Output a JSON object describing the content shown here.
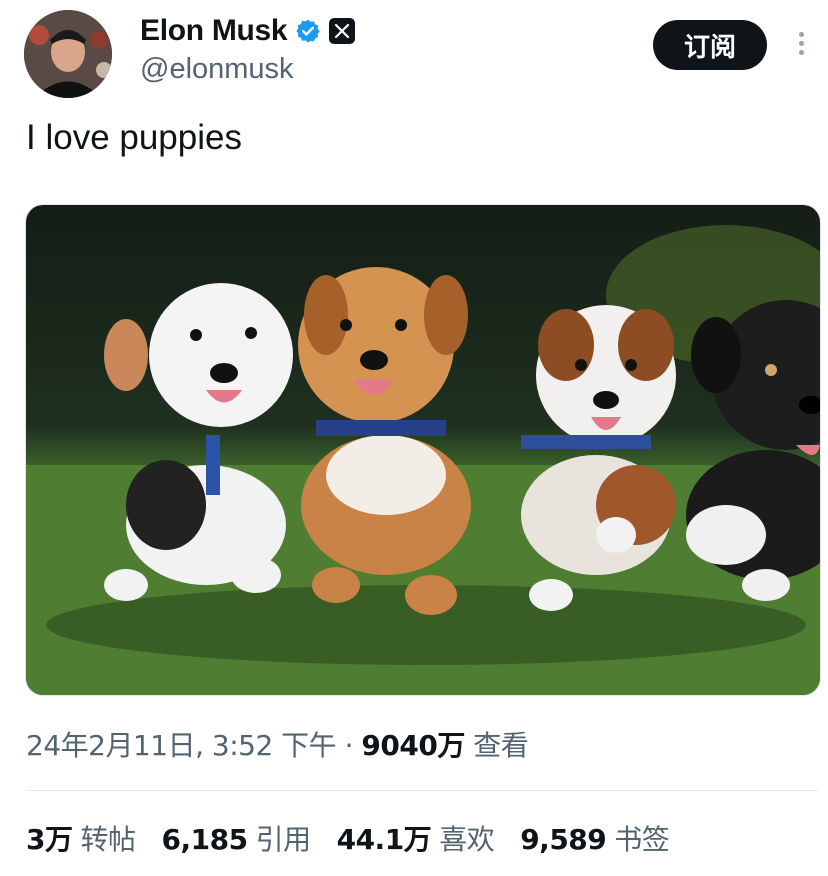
{
  "author": {
    "display_name": "Elon Musk",
    "handle": "@elonmusk",
    "verified_icon": "verified-badge-icon",
    "affiliation_icon": "x-logo-icon"
  },
  "actions": {
    "subscribe_label": "订阅",
    "more_icon": "more-vertical-icon"
  },
  "tweet": {
    "text": "I love puppies",
    "media_alt": "puppies running on grass"
  },
  "meta": {
    "date": "24年2月11日",
    "time": "3:52 下午",
    "separator": "·",
    "views_count": "9040万",
    "views_label": "查看"
  },
  "stats": [
    {
      "count": "3万",
      "label": "转帖"
    },
    {
      "count": "6,185",
      "label": "引用"
    },
    {
      "count": "44.1万",
      "label": "喜欢"
    },
    {
      "count": "9,589",
      "label": "书签"
    }
  ],
  "colors": {
    "text_primary": "#0f1419",
    "text_secondary": "#536471",
    "verified_blue": "#1d9bf0",
    "button_bg": "#0f1419"
  }
}
